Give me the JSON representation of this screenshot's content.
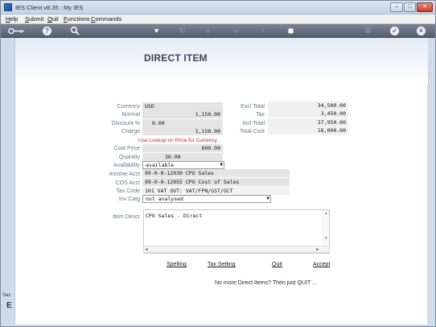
{
  "window": {
    "title": "IES Client v8.35 : My IES"
  },
  "menu": [
    {
      "label": "Help",
      "ul": "H",
      "rest": "elp"
    },
    {
      "label": "Submit",
      "ul": "S",
      "rest": "ubmit"
    },
    {
      "label": "Quit",
      "ul": "Q",
      "rest": "uit"
    },
    {
      "label": "Functions",
      "ul": "F",
      "rest": "unctions"
    },
    {
      "label": "Commands",
      "ul": "C",
      "rest": "ommands"
    }
  ],
  "toolbar": {
    "icons": [
      "back-key-icon",
      "help-icon",
      "search-icon",
      "heart-icon",
      "refresh-icon",
      "rewind-icon",
      "forward-icon",
      "upload-icon",
      "stop-icon",
      "settings-icon",
      "ok-icon",
      "close-icon"
    ],
    "help_glyph": "?",
    "ok_glyph": "✓",
    "close_glyph": "x"
  },
  "page": {
    "title": "DIRECT ITEM"
  },
  "form": {
    "currency": {
      "label": "Currency",
      "value": "USD"
    },
    "normal": {
      "label": "Normal",
      "value": "1,150.00"
    },
    "discount": {
      "label": "Discount %",
      "value": "0.00"
    },
    "charge": {
      "label": "Charge",
      "value": "1,150.00"
    },
    "hint": "Use Lookup on Price for Currency",
    "cost_price": {
      "label": "Cost Price",
      "value": "600.00"
    },
    "quantity": {
      "label": "Quantity",
      "value": "30.00"
    },
    "availability": {
      "label": "Availability",
      "value": "available"
    },
    "income_acct": {
      "label": "Income Acct",
      "value": "99-0-0-12030 CPO Sales"
    },
    "cos_acct": {
      "label": "COS Acct",
      "value": "99-0-0-12055 CPO Cost of Sales"
    },
    "tax_code": {
      "label": "Tax Code",
      "value": "101 VAT OUT: VAT/FPN/GST/GCT"
    },
    "inv_catg": {
      "label": "Inv Catg",
      "value": "not analysed"
    },
    "item_descr": {
      "label": "Item Descr",
      "value": "CPO Sales - Direct"
    }
  },
  "totals": {
    "excl_total": {
      "label": "Excl Total",
      "value": "34,500.00"
    },
    "tax": {
      "label": "Tax",
      "value": "3,450.00"
    },
    "incl_total": {
      "label": "Incl Total",
      "value": "37,950.00"
    },
    "total_cost": {
      "label": "Total Cost",
      "value": "18,000.00"
    }
  },
  "actions": {
    "spelling": "Spelling",
    "tax_setting": "Tax Setting",
    "quit": "Quit",
    "accept": "Accept"
  },
  "footer": {
    "message": "No more Direct Items? Then just QUIT ..."
  },
  "left_strip": {
    "text": "Ses",
    "icon": "E"
  }
}
